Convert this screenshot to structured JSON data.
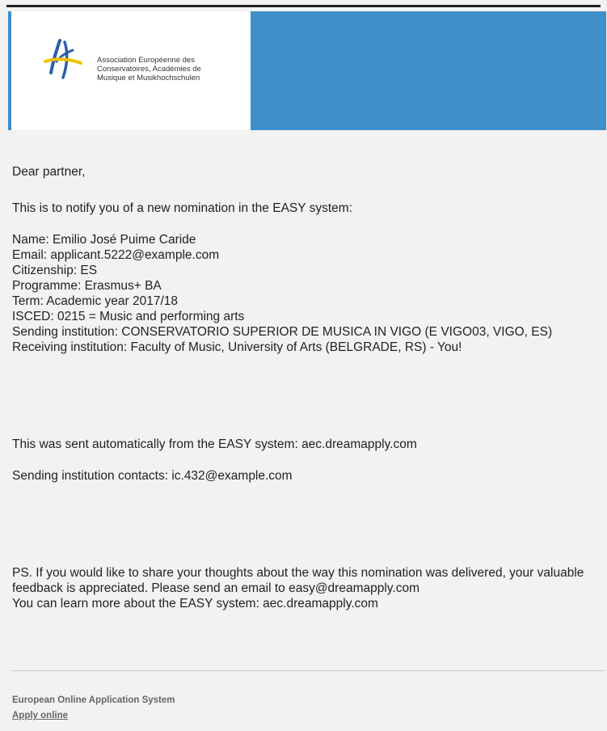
{
  "header": {
    "logo_lines": [
      "Association Européenne des",
      "Conservatoires, Académies de",
      "Musique et Musikhochschulen"
    ],
    "colors": {
      "accent_blue": "#3e8fca",
      "logo_blue": "#2b5fa6",
      "logo_yellow": "#f2c200"
    },
    "logo_icon": "aec-logo-icon"
  },
  "email": {
    "greeting": "Dear partner,",
    "intro": "This is to notify you of a new nomination in the EASY system:",
    "details": [
      "Name: Emilio José Puime Caride",
      "Email: applicant.5222@example.com",
      "Citizenship: ES",
      "Programme: Erasmus+ BA",
      "Term: Academic year 2017/18",
      "ISCED: 0215 = Music and performing arts",
      "Sending institution: CONSERVATORIO SUPERIOR DE MUSICA IN VIGO (E VIGO03, VIGO, ES)",
      "Receiving institution: Faculty of Music, University of Arts (BELGRADE, RS) - You!"
    ],
    "auto_sent": "This was sent automatically from the EASY system: aec.dreamapply.com",
    "contacts": "Sending institution contacts: ic.432@example.com",
    "ps_lines": [
      "PS. If you would like to share your thoughts about the way this nomination was delivered, your valuable feedback is appreciated. Please send an email to easy@dreamapply.com",
      "You can learn more about the EASY system: aec.dreamapply.com"
    ]
  },
  "footer": {
    "title": "European Online Application System",
    "link": "Apply online"
  }
}
